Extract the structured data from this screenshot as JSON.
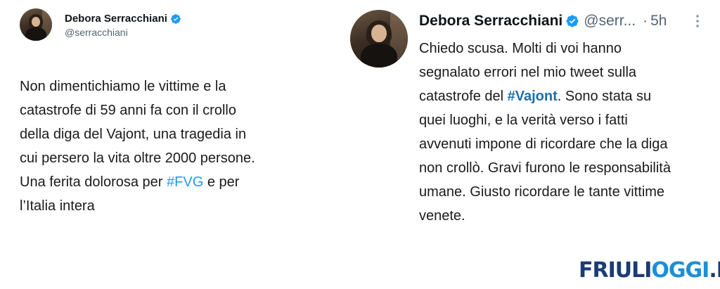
{
  "tweets": [
    {
      "author": "Debora Serracchiani",
      "handle": "@serracchiani",
      "text_before": "Non dimentichiamo le vittime e la\ncatastrofe di 59 anni fa con il crollo\ndella diga del Vajont, una tragedia in\ncui persero la vita oltre 2000 persone.\nUna ferita dolorosa per ",
      "hashtag": "#FVG",
      "text_after": " e per\nl’Italia intera"
    },
    {
      "author": "Debora Serracchiani",
      "handle": "@serr...",
      "separator": "·",
      "time": "5h",
      "more_icon": "more-vertical-icon",
      "text_before": "Chiedo scusa. Molti di voi hanno\nsegnalato errori nel mio tweet sulla\ncatastrofe del ",
      "hashtag": "#Vajont",
      "text_after": ". Sono stata su\nquei luoghi, e la verità verso i fatti\navvenuti impone di ricordare che la diga\nnon crollò. Gravi furono le responsabilità\numane. Giusto ricordare le tante vittime\nvenete."
    }
  ],
  "watermark": {
    "part1": "FRIULI",
    "part2": "OGGI",
    "part3": ".IT"
  },
  "colors": {
    "verified": "#1d9bf0",
    "hashtag": "#1d9bf0",
    "logo_dark": "#1b3c74",
    "logo_light": "#1c8fd6"
  }
}
